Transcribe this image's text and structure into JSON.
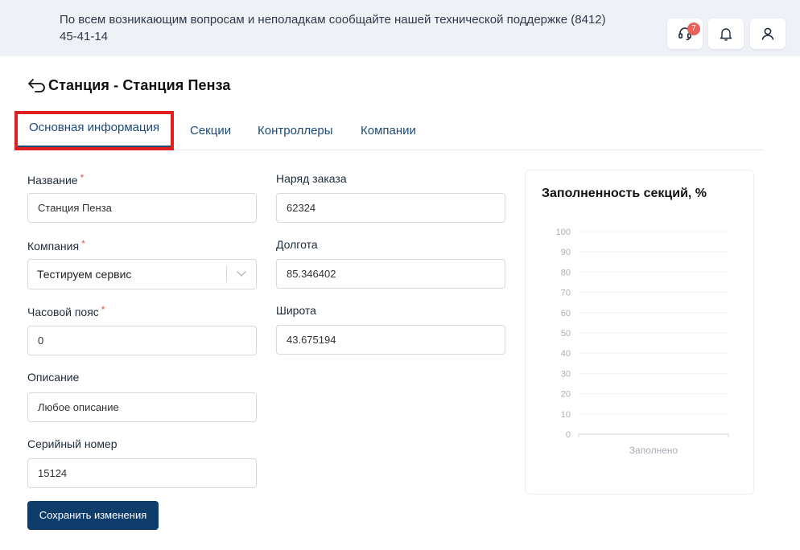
{
  "header": {
    "notice": "По всем возникающим вопросам и неполадкам сообщайте нашей технической поддержке (8412) 45-41-14",
    "support_badge": "7"
  },
  "page": {
    "title": "Станция - Станция Пенза"
  },
  "tabs": [
    {
      "label": "Основная информация"
    },
    {
      "label": "Секции"
    },
    {
      "label": "Контроллеры"
    },
    {
      "label": "Компании"
    }
  ],
  "form": {
    "name": {
      "label": "Название",
      "value": "Станция Пенза"
    },
    "company": {
      "label": "Компания",
      "value": "Тестируем сервис"
    },
    "timezone": {
      "label": "Часовой пояс",
      "value": "0"
    },
    "description": {
      "label": "Описание",
      "value": "Любое описание"
    },
    "serial": {
      "label": "Серийный номер",
      "value": "15124"
    },
    "order": {
      "label": "Наряд заказа",
      "value": "62324"
    },
    "longitude": {
      "label": "Долгота",
      "value": "85.346402"
    },
    "latitude": {
      "label": "Широта",
      "value": "43.675194"
    },
    "required_mark": "*",
    "save_label": "Сохранить изменения"
  },
  "chart_data": {
    "type": "bar",
    "title": "Заполненность секций, %",
    "categories": [
      "Заполнено"
    ],
    "values": [
      0
    ],
    "ylim": [
      0,
      100
    ],
    "yticks": [
      "0",
      "10",
      "20",
      "30",
      "40",
      "50",
      "60",
      "70",
      "80",
      "90",
      "100"
    ],
    "grid": true
  }
}
